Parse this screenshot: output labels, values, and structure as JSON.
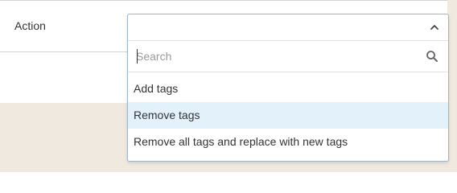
{
  "field": {
    "label": "Action"
  },
  "dropdown": {
    "selected_value": "",
    "search": {
      "value": "",
      "placeholder": "Search"
    },
    "options": [
      {
        "label": "Add tags",
        "highlighted": false
      },
      {
        "label": "Remove tags",
        "highlighted": true
      },
      {
        "label": "Remove all tags and replace with new tags",
        "highlighted": false
      }
    ]
  },
  "icons": {
    "toggle": "chevron-up-icon",
    "search": "search-icon"
  },
  "colors": {
    "page_background": "#f0e9df",
    "dropdown_border": "#9fb6c9",
    "option_highlight": "#e3f1fb"
  }
}
